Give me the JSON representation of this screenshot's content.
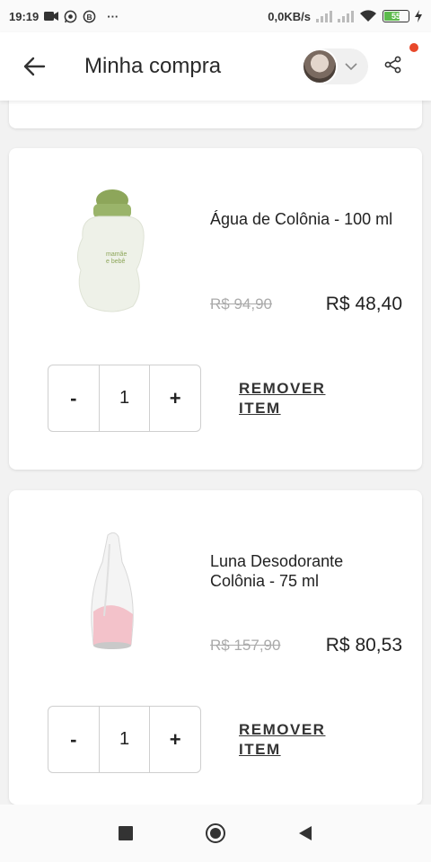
{
  "status_bar": {
    "time": "19:19",
    "net_speed": "0,0KB/s",
    "battery": "55",
    "more": "···"
  },
  "header": {
    "title": "Minha compra"
  },
  "colors": {
    "accent_dot": "#e8482a",
    "battery_fill": "#5dbb4d"
  },
  "products": [
    {
      "name": "Água de Colônia - 100 ml",
      "old_price": "R$ 94,90",
      "new_price": "R$ 48,40",
      "quantity": "1",
      "minus_label": "-",
      "plus_label": "+",
      "remove_label": "REMOVER ITEM"
    },
    {
      "name": "Luna Desodorante Colônia - 75 ml",
      "old_price": "R$ 157,90",
      "new_price": "R$ 80,53",
      "quantity": "1",
      "minus_label": "-",
      "plus_label": "+",
      "remove_label": "REMOVER ITEM"
    }
  ]
}
